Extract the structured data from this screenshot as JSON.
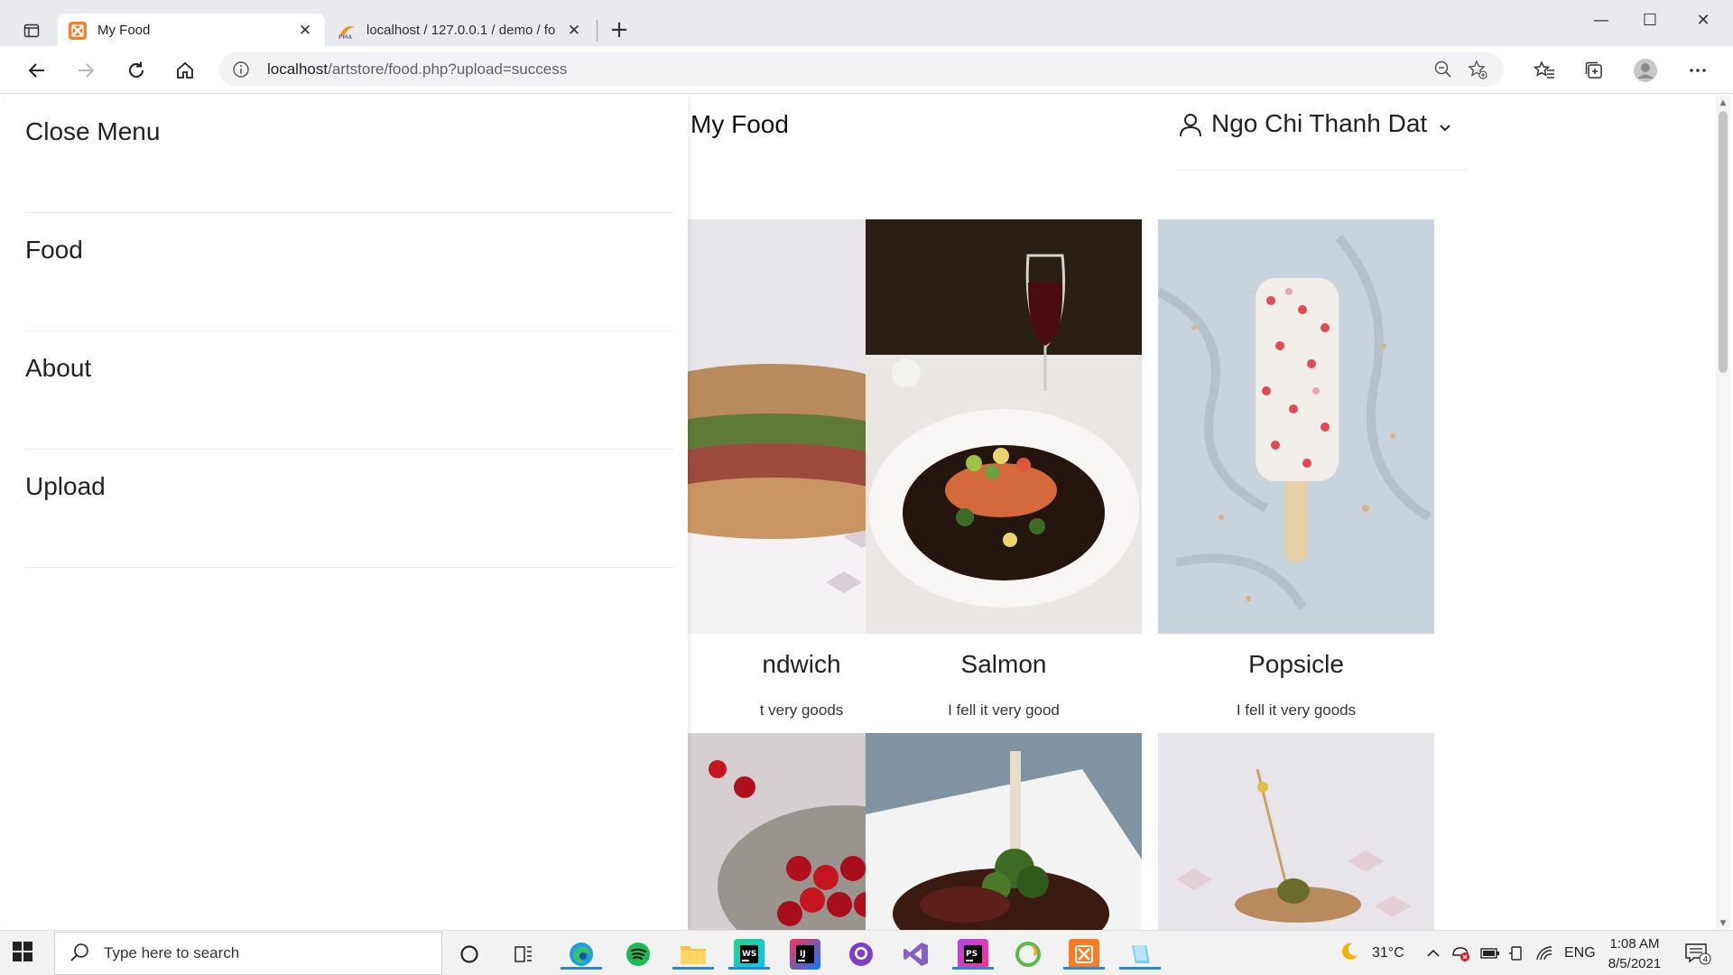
{
  "browser": {
    "tabs": [
      {
        "title": "My Food",
        "active": true,
        "favicon": "xampp-icon"
      },
      {
        "title": "localhost / 127.0.0.1 / demo / fo",
        "active": false,
        "favicon": "phpmyadmin-icon"
      }
    ],
    "url_host": "localhost",
    "url_path": "/artstore/food.php?upload=success"
  },
  "page": {
    "site_title": "My Food",
    "user_name": "Ngo Chi Thanh Dat",
    "sidebar": {
      "items": [
        {
          "label": "Close Menu"
        },
        {
          "label": "Food"
        },
        {
          "label": "About"
        },
        {
          "label": "Upload"
        }
      ]
    },
    "foods": [
      {
        "name": "ndwich",
        "description": "t very goods",
        "photo": "sandwich"
      },
      {
        "name": "Salmon",
        "description": "I fell it very good",
        "photo": "salmon"
      },
      {
        "name": "Popsicle",
        "description": "I fell it very goods",
        "photo": "popsicle"
      },
      {
        "photo": "cherries"
      },
      {
        "photo": "steak"
      },
      {
        "photo": "skewer"
      }
    ]
  },
  "taskbar": {
    "search_placeholder": "Type here to search",
    "weather": "31°C",
    "language": "ENG",
    "time": "1:08 AM",
    "date": "8/5/2021",
    "notifications": "4",
    "apps": [
      "cortana-icon",
      "task-view-icon",
      "edge-icon",
      "spotify-icon",
      "file-explorer-icon",
      "webstorm-icon",
      "intellij-icon",
      "github-desktop-icon",
      "visual-studio-icon",
      "phpstorm-icon",
      "coccoc-icon",
      "xampp-icon",
      "notepad-icon"
    ]
  }
}
